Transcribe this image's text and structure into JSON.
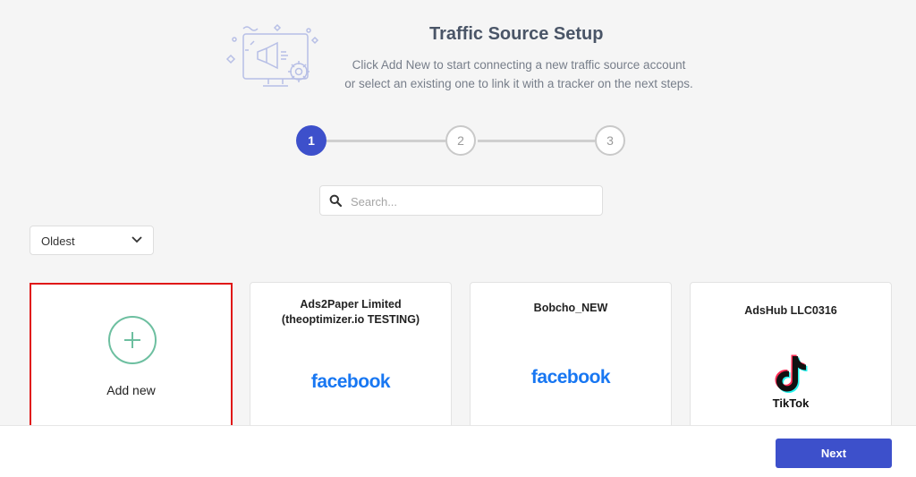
{
  "header": {
    "title": "Traffic Source Setup",
    "subtitle_line1": "Click Add New to start connecting a new traffic source account",
    "subtitle_line2": "or select an existing one to link it with a tracker on the next steps."
  },
  "stepper": {
    "steps": [
      "1",
      "2",
      "3"
    ],
    "active_step": 1
  },
  "search": {
    "placeholder": "Search...",
    "value": ""
  },
  "sort": {
    "selected": "Oldest"
  },
  "cards": {
    "add_new": {
      "label": "Add new"
    },
    "items": [
      {
        "title_line1": "Ads2Paper Limited",
        "title_line2": "(theoptimizer.io TESTING)",
        "platform": "facebook",
        "icon": "facebook-logo"
      },
      {
        "title_line1": "Bobcho_NEW",
        "title_line2": "",
        "platform": "facebook",
        "icon": "facebook-logo"
      },
      {
        "title_line1": "AdsHub LLC0316",
        "title_line2": "",
        "platform": "TikTok",
        "icon": "tiktok-logo"
      }
    ]
  },
  "footer": {
    "next_label": "Next"
  },
  "colors": {
    "primary": "#3d50cb",
    "facebook": "#1877f2",
    "highlight_border": "#e01818",
    "add_circle": "#6dbfa0"
  }
}
